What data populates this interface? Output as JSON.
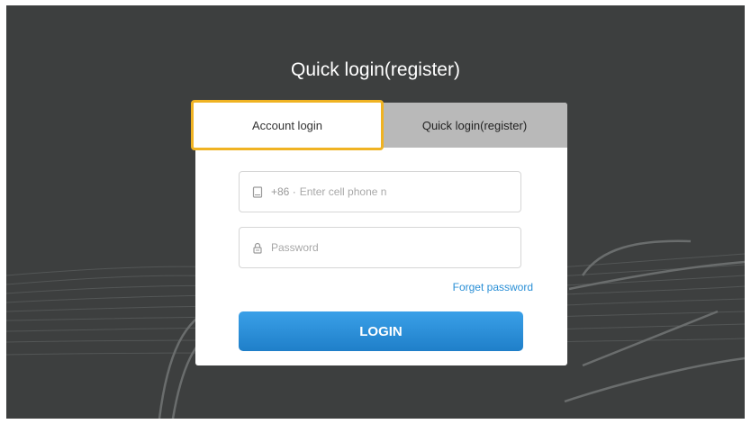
{
  "page": {
    "title": "Quick login(register)"
  },
  "tabs": {
    "account_label": "Account login",
    "quick_label": "Quick login(register)",
    "selected": "Account login"
  },
  "phone_field": {
    "icon": "phone-icon",
    "country_code": "+86 ·",
    "placeholder": "Enter cell phone n",
    "value": ""
  },
  "password_field": {
    "icon": "lock-icon",
    "placeholder": "Password",
    "value": ""
  },
  "forget_password_label": "Forget password",
  "login_button_label": "LOGIN",
  "colors": {
    "background": "#3d3f3f",
    "highlight_border": "#f0b323",
    "inactive_tab": "#b9b9b9",
    "link": "#2a8fd6",
    "button": "#2a8fd6"
  }
}
